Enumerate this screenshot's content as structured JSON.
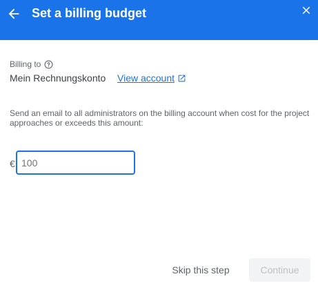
{
  "header": {
    "title": "Set a billing budget",
    "back_icon": "arrow-back-icon",
    "close_icon": "close-icon",
    "background_color": "#1a73e8"
  },
  "billing": {
    "label": "Billing to",
    "help_icon": "help-circle-icon",
    "account_name": "Mein Rechnungskonto",
    "view_account_label": "View account",
    "view_account_icon": "open-in-new-icon",
    "link_color": "#1a73e8"
  },
  "description": "Send an email to all administrators on the billing account when cost for the project approaches or exceeds this amount:",
  "budget": {
    "currency_symbol": "€",
    "placeholder": "100",
    "value": ""
  },
  "footer": {
    "skip_label": "Skip this step",
    "continue_label": "Continue"
  }
}
